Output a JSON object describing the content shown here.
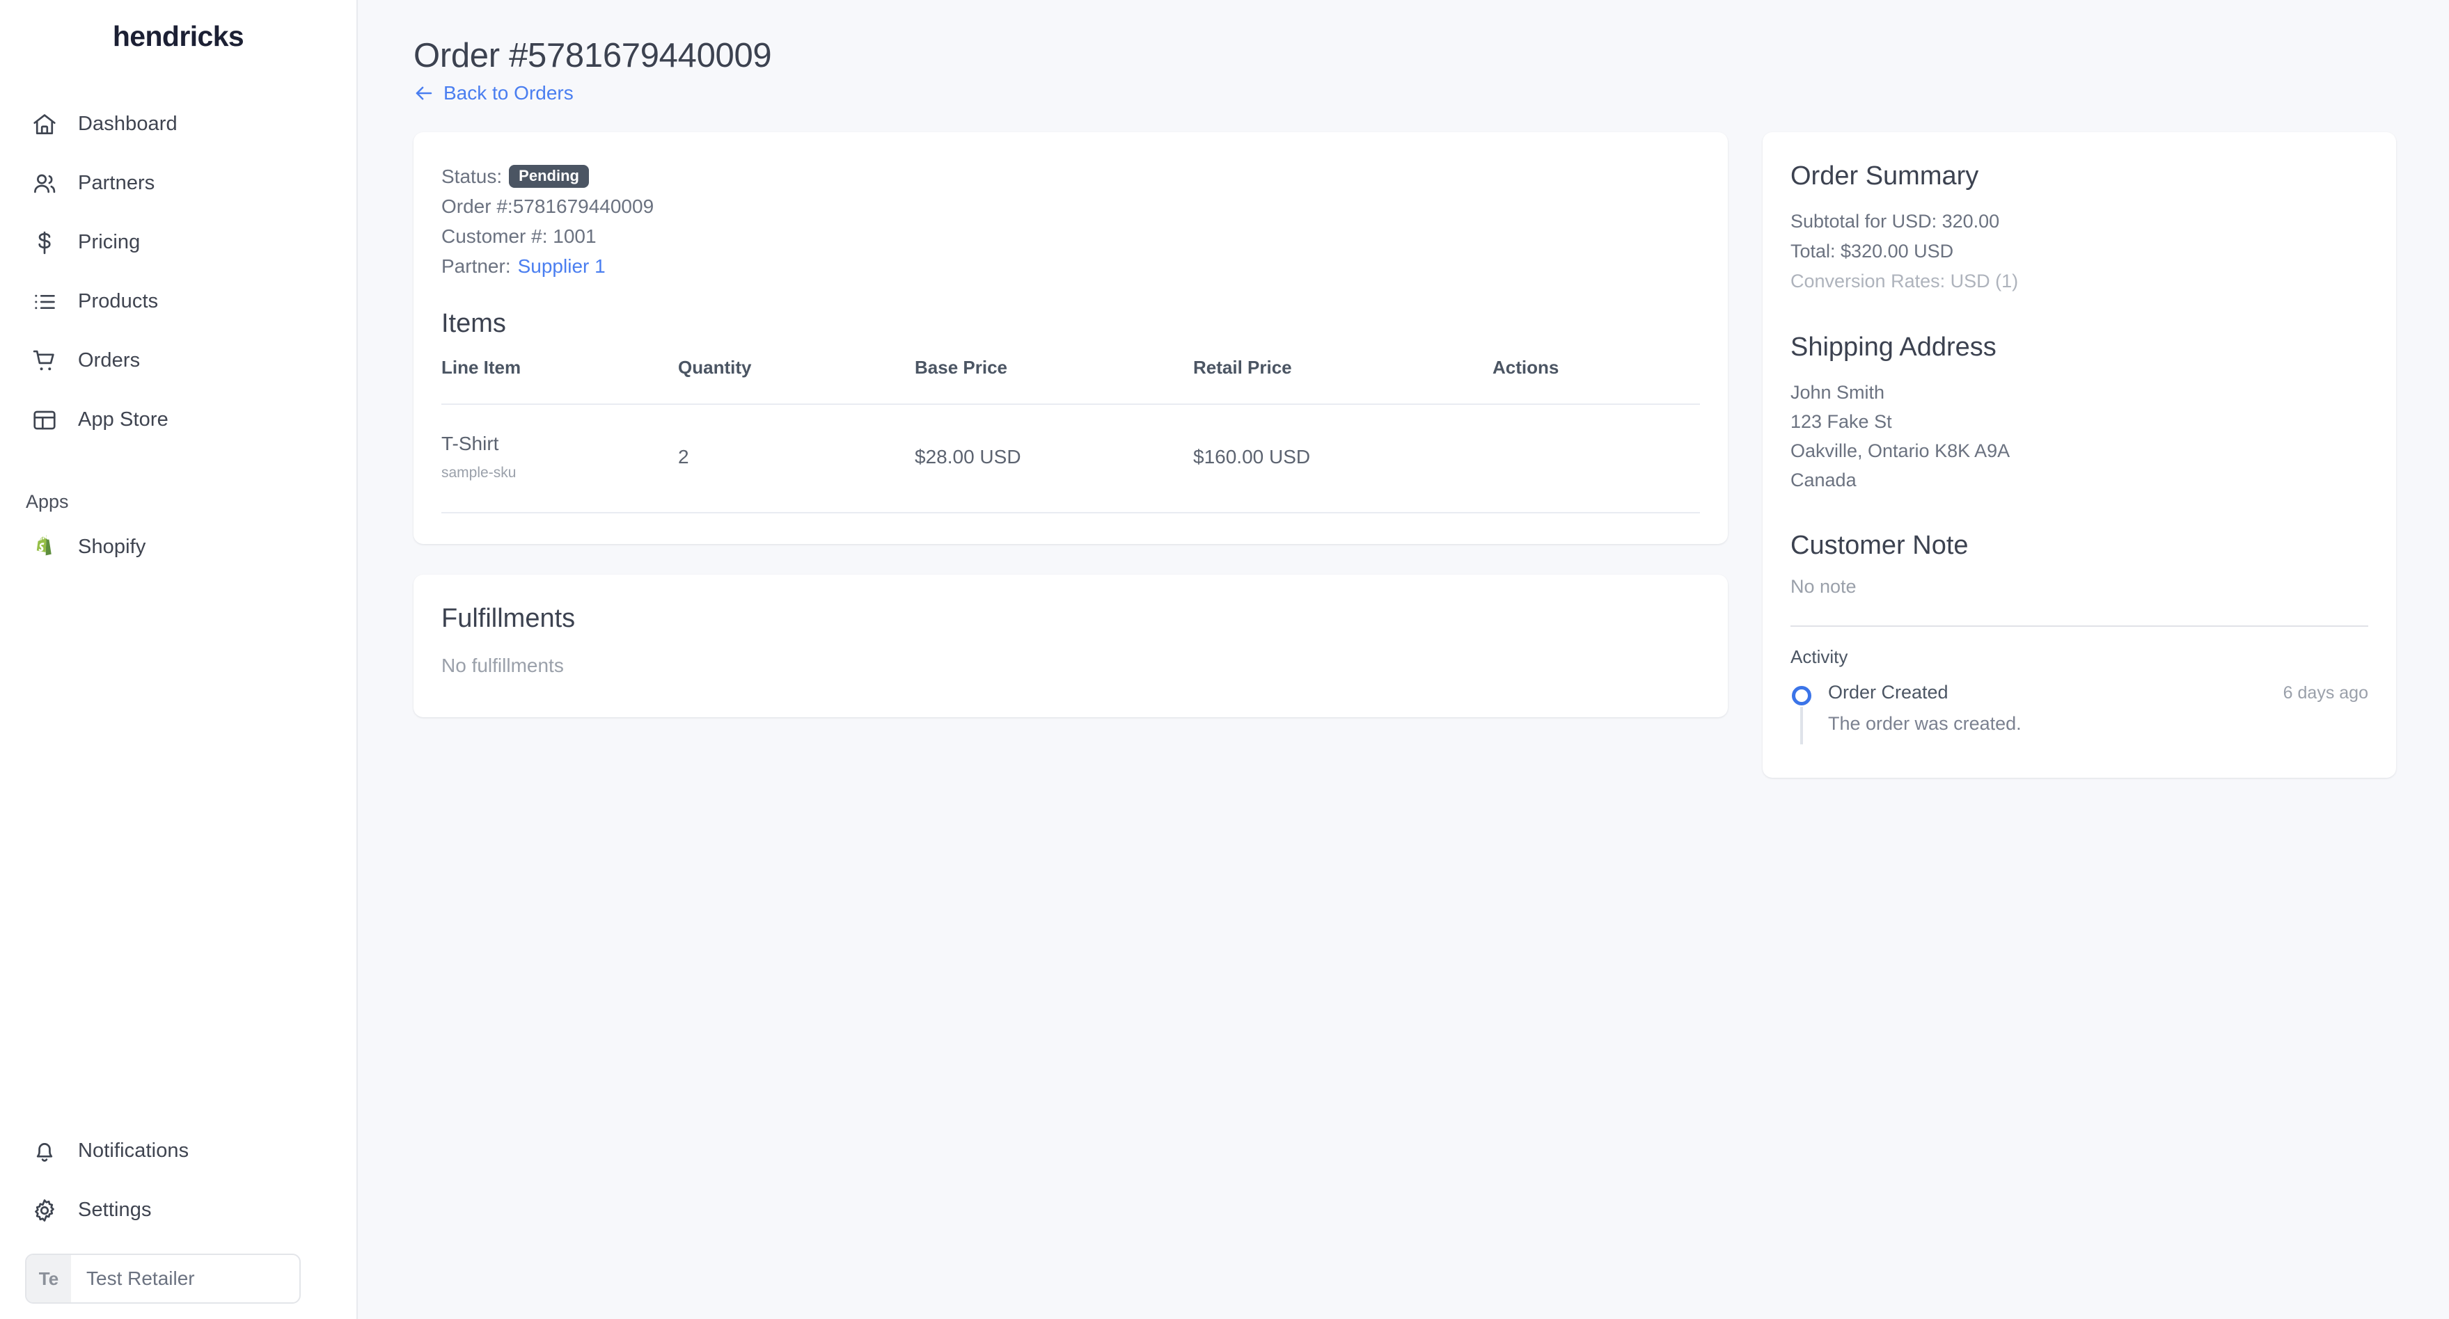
{
  "sidebar": {
    "brand": "hendricks",
    "nav_items": [
      {
        "label": "Dashboard",
        "icon": "home-icon"
      },
      {
        "label": "Partners",
        "icon": "users-icon"
      },
      {
        "label": "Pricing",
        "icon": "dollar-icon"
      },
      {
        "label": "Products",
        "icon": "list-icon"
      },
      {
        "label": "Orders",
        "icon": "cart-icon"
      },
      {
        "label": "App Store",
        "icon": "layout-icon"
      }
    ],
    "apps_heading": "Apps",
    "apps": [
      {
        "label": "Shopify",
        "icon": "shopify-icon"
      }
    ],
    "bottom_items": [
      {
        "label": "Notifications",
        "icon": "bell-icon"
      },
      {
        "label": "Settings",
        "icon": "gear-icon"
      }
    ],
    "retailer": {
      "initials": "Te",
      "name": "Test Retailer"
    }
  },
  "header": {
    "title": "Order #5781679440009",
    "back_link": "Back to Orders"
  },
  "order_meta": {
    "status_label": "Status:",
    "status_value": "Pending",
    "order_number": "Order #:5781679440009",
    "customer_number": "Customer #: 1001",
    "partner_label": "Partner:",
    "partner_value": "Supplier 1"
  },
  "items": {
    "title": "Items",
    "columns": [
      "Line Item",
      "Quantity",
      "Base Price",
      "Retail Price",
      "Actions"
    ],
    "rows": [
      {
        "name": "T-Shirt",
        "sku": "sample-sku",
        "quantity": "2",
        "base_price": "$28.00 USD",
        "retail_price": "$160.00 USD",
        "actions": ""
      }
    ]
  },
  "fulfillments": {
    "title": "Fulfillments",
    "empty": "No fulfillments"
  },
  "summary": {
    "title": "Order Summary",
    "subtotal": "Subtotal for USD: 320.00",
    "total": "Total: $320.00 USD",
    "conversion": "Conversion Rates: USD (1)"
  },
  "shipping": {
    "title": "Shipping Address",
    "lines": [
      "John Smith",
      "123 Fake St",
      "Oakville, Ontario K8K A9A",
      "Canada"
    ]
  },
  "customer_note": {
    "title": "Customer Note",
    "value": "No note"
  },
  "activity": {
    "title": "Activity",
    "entries": [
      {
        "label": "Order Created",
        "time": "6 days ago",
        "description": "The order was created."
      }
    ]
  },
  "colors": {
    "accent_link": "#4a7ef0",
    "status_badge_bg": "#4b5563",
    "timeline_dot": "#3b74e8",
    "page_bg": "#f7f8fb",
    "shopify_green": "#95bf47"
  }
}
